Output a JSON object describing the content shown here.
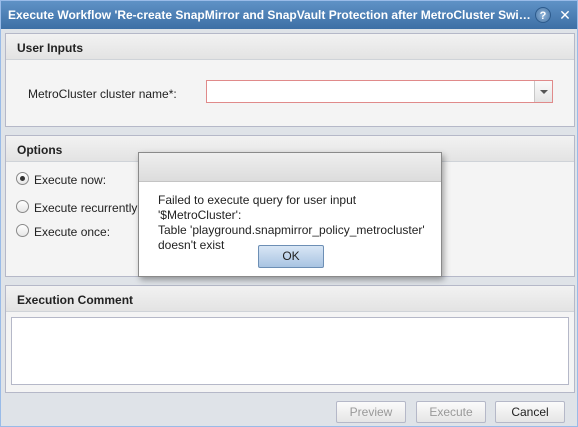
{
  "window": {
    "title": "Execute Workflow 'Re-create SnapMirror and SnapVault Protection after MetroCluster Switch..."
  },
  "icons": {
    "help": "question-icon",
    "close": "close-icon"
  },
  "user_inputs": {
    "header": "User Inputs",
    "cluster_label": "MetroCluster cluster name*:",
    "cluster_value": ""
  },
  "options": {
    "header": "Options",
    "radios": [
      {
        "label": "Execute now:",
        "checked": true
      },
      {
        "label": "Execute recurrently:",
        "checked": false
      },
      {
        "label": "Execute once:",
        "checked": false
      }
    ]
  },
  "comment": {
    "header": "Execution Comment",
    "value": ""
  },
  "footer": {
    "preview_label": "Preview",
    "execute_label": "Execute",
    "cancel_label": "Cancel"
  },
  "dialog": {
    "line1": "Failed to execute query for user input '$MetroCluster':",
    "line2": "Table 'playground.snapmirror_policy_metrocluster'",
    "line3": "doesn't exist",
    "ok_label": "OK"
  }
}
